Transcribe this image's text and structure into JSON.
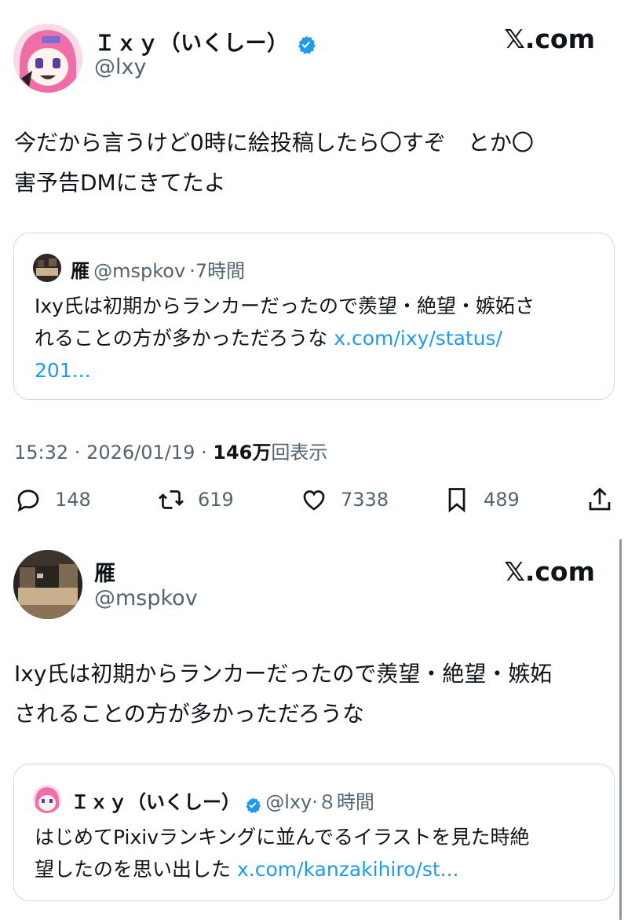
{
  "tweet1": {
    "author_name": "Ｉｘｙ（いくしー）",
    "handle": "@lxy",
    "site": "𝕏.com",
    "text_line1": "今だから言うけど0時に絵投稿したら〇すぞ　とか〇",
    "text_line2": "害予告DMにきてたよ",
    "quote": {
      "author_name": "雁",
      "handle": "@mspkov",
      "time": "·7時間",
      "text_line1": "Ixy氏は初期からランカーだったので羨望・絶望・嫉妬さ",
      "text_line2": "れることの方が多かっただろうな",
      "link_part1": "x.com/ixy/status/",
      "link_part2": "201..."
    },
    "timestamp": "15:32 · 2026/01/19 · ",
    "views_count": "146万",
    "views_label": "回表示",
    "actions": {
      "replies": "148",
      "retweets": "619",
      "likes": "7338",
      "bookmarks": "489"
    }
  },
  "tweet2": {
    "author_name": "雁",
    "handle": "@mspkov",
    "site": "𝕏.com",
    "text_line1": "Ixy氏は初期からランカーだったので羨望・絶望・嫉妬",
    "text_line2": "されることの方が多かっただろうな",
    "quote": {
      "author_name": "Ｉｘｙ（いくしー）",
      "handle": "@lxy",
      "time": "·８時間",
      "text_line1": "はじめてPixivランキングに並んでるイラストを見た時絶",
      "text_line2": "望したのを思い出した ",
      "link": "x.com/kanzakihiro/st..."
    }
  },
  "colors": {
    "accent": "#1d9bf0",
    "secondary": "#536471",
    "border": "#cfd9de"
  },
  "icons": [
    "verified-badge-icon",
    "reply-icon",
    "retweet-icon",
    "like-icon",
    "bookmark-icon",
    "share-icon"
  ]
}
